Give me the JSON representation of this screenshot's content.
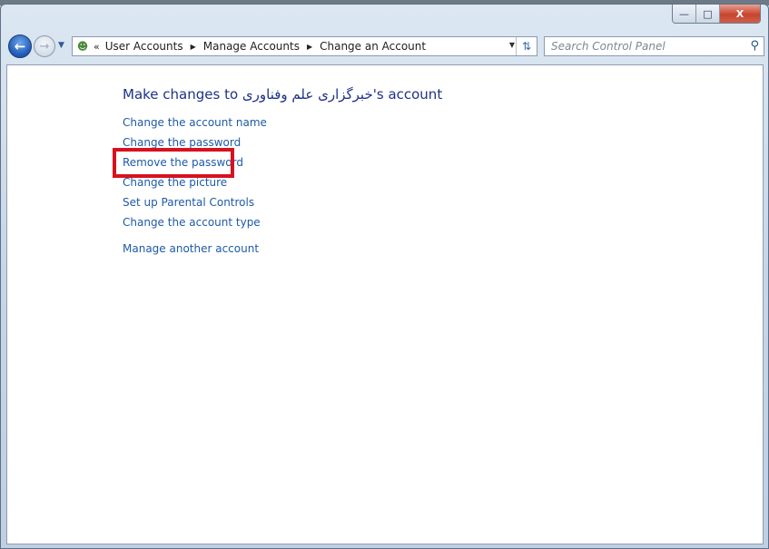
{
  "window": {
    "caption_buttons": {
      "minimize": "—",
      "maximize": "□",
      "close": "X"
    },
    "accent_highlight": "#d7121f"
  },
  "nav": {
    "back_icon": "back-arrow-icon",
    "forward_icon": "forward-arrow-icon",
    "breadcrumb": [
      "User Accounts",
      "Manage Accounts",
      "Change an Account"
    ],
    "search_placeholder": "Search Control Panel"
  },
  "main": {
    "title_prefix": "Make changes to ",
    "account_name": "خبرگزاری علم وفناوری",
    "title_suffix": "'s account",
    "links": [
      "Change the account name",
      "Change the password",
      "Remove the password",
      "Change the picture",
      "Set up Parental Controls",
      "Change the account type"
    ],
    "manage_other": "Manage another account"
  }
}
